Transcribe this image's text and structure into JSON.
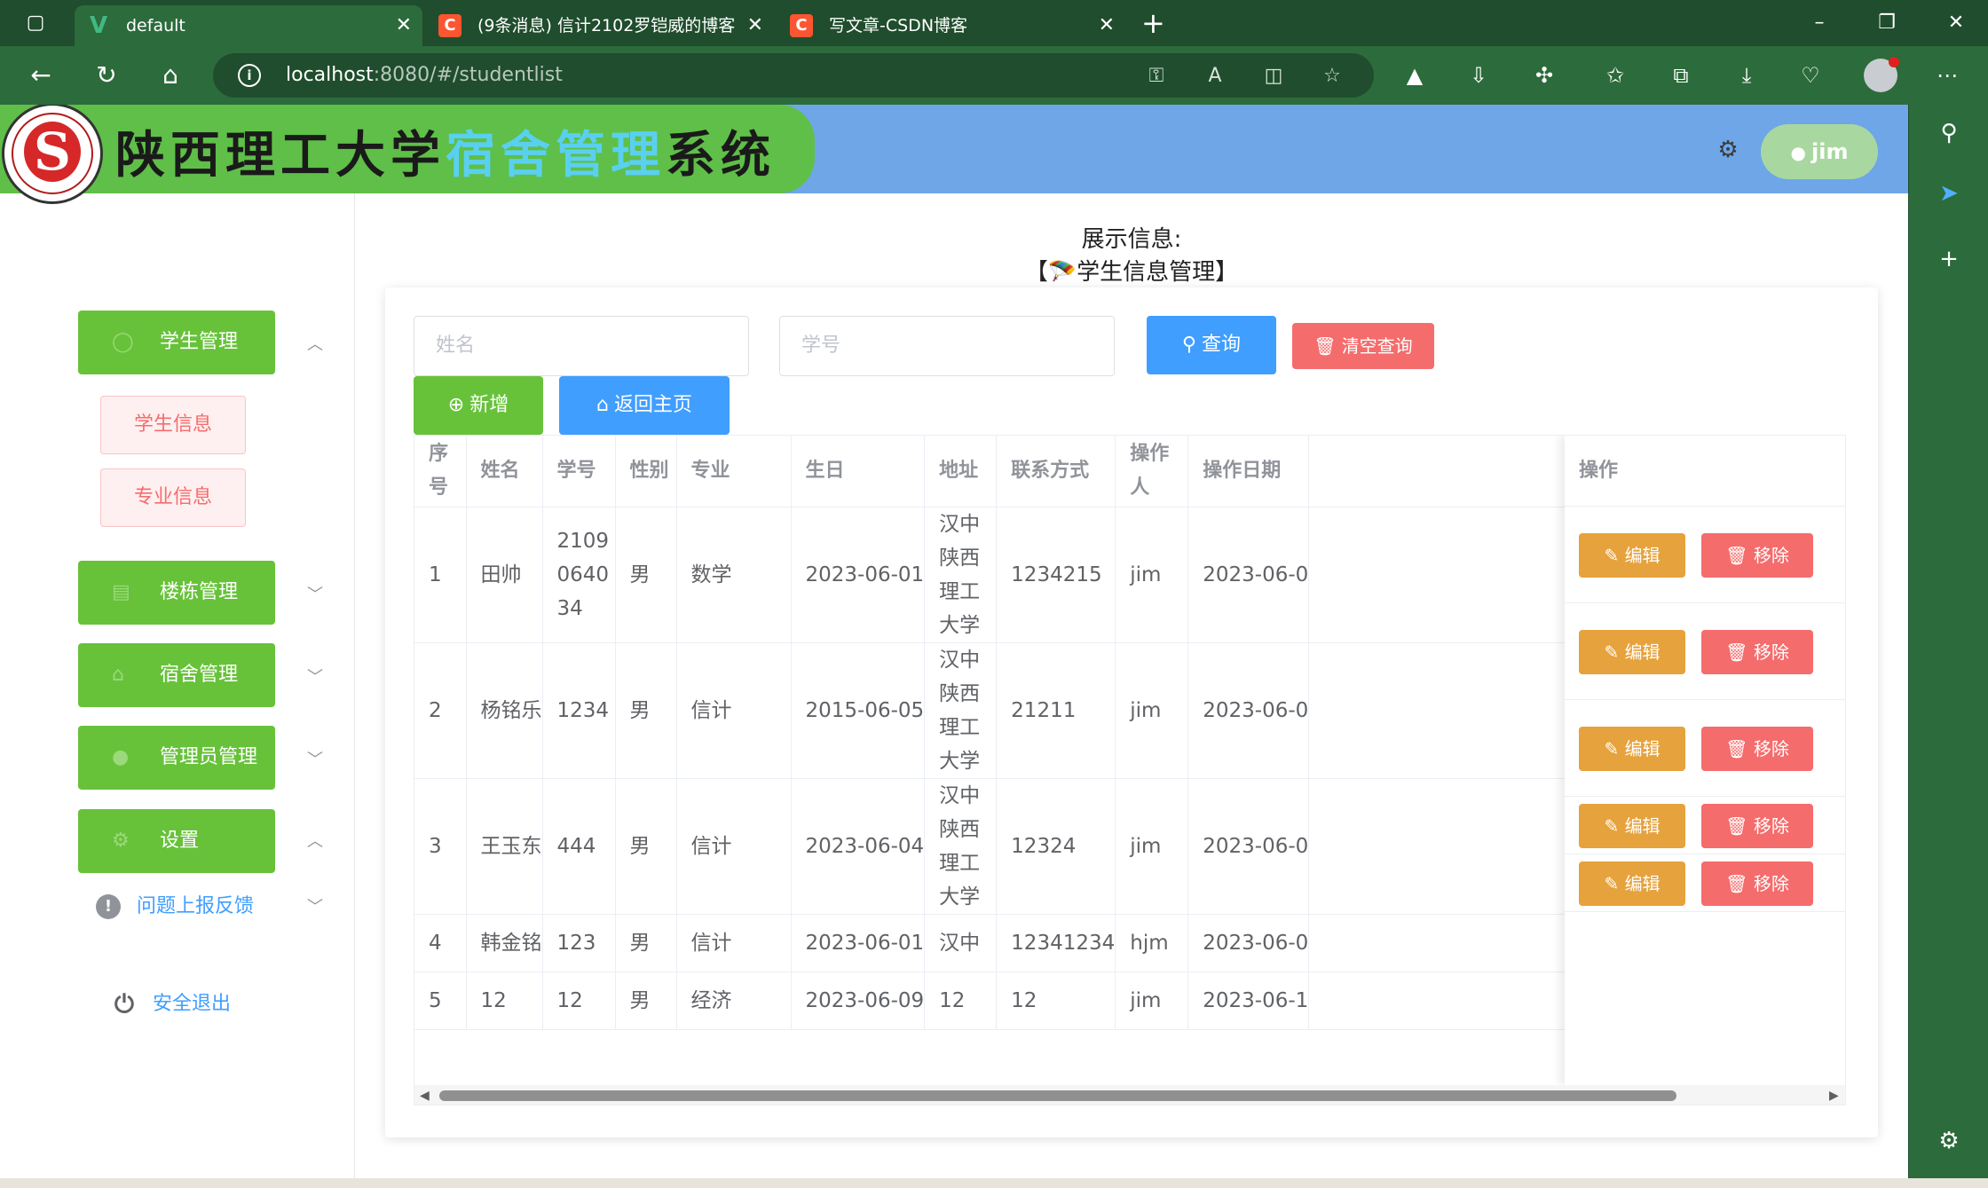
{
  "browser": {
    "tabs": [
      {
        "title": "default",
        "icon": "vue-icon",
        "active": true
      },
      {
        "title": "(9条消息) 信计2102罗铠威的博客",
        "icon": "csdn-icon",
        "active": false
      },
      {
        "title": "写文章-CSDN博客",
        "icon": "csdn-icon",
        "active": false
      }
    ],
    "url_host": "localhost",
    "url_rest": ":8080/#/studentlist",
    "accent": "#2c6b3b"
  },
  "header": {
    "title_part1": "陕西理工大学",
    "title_part2": "宿舍管理",
    "title_part3": "系统",
    "user": "jim"
  },
  "sidebar": {
    "menus": [
      {
        "label": "学生管理",
        "icon": "user-icon",
        "expanded": true
      },
      {
        "label": "楼栋管理",
        "icon": "building-icon",
        "expanded": false
      },
      {
        "label": "宿舍管理",
        "icon": "home-icon",
        "expanded": false
      },
      {
        "label": "管理员管理",
        "icon": "admin-icon",
        "expanded": false
      },
      {
        "label": "设置",
        "icon": "gear-icon",
        "expanded": true
      }
    ],
    "sub_items": [
      "学生信息",
      "专业信息"
    ],
    "feedback": "问题上报反馈",
    "logout": "安全退出"
  },
  "main": {
    "caption_line1": "展示信息:",
    "caption_line2": "【🪂学生信息管理】",
    "search": {
      "name_placeholder": "姓名",
      "id_placeholder": "学号",
      "query_label": "查询",
      "clear_label": "清空查询"
    },
    "add_label": "新增",
    "home_label": "返回主页",
    "table": {
      "columns": [
        "序号",
        "姓名",
        "学号",
        "性别",
        "专业",
        "生日",
        "地址",
        "联系方式",
        "操作人",
        "操作日期",
        "操作"
      ],
      "rows": [
        [
          "1",
          "田帅",
          "2109064034",
          "男",
          "数学",
          "2023-06-01",
          "汉中陕西理工大学",
          "1234215",
          "jim",
          "2023-06-0"
        ],
        [
          "2",
          "杨铭乐",
          "1234",
          "男",
          "信计",
          "2015-06-05",
          "汉中陕西理工大学",
          "21211",
          "jim",
          "2023-06-0"
        ],
        [
          "3",
          "王玉东",
          "444",
          "男",
          "信计",
          "2023-06-04",
          "汉中陕西理工大学",
          "12324",
          "jim",
          "2023-06-0"
        ],
        [
          "4",
          "韩金铭",
          "123",
          "男",
          "信计",
          "2023-06-01",
          "汉中",
          "12341234",
          "hjm",
          "2023-06-0"
        ],
        [
          "5",
          "12",
          "12",
          "男",
          "经济",
          "2023-06-09",
          "12",
          "12",
          "jim",
          "2023-06-1"
        ]
      ],
      "edit_label": "编辑",
      "remove_label": "移除"
    }
  }
}
